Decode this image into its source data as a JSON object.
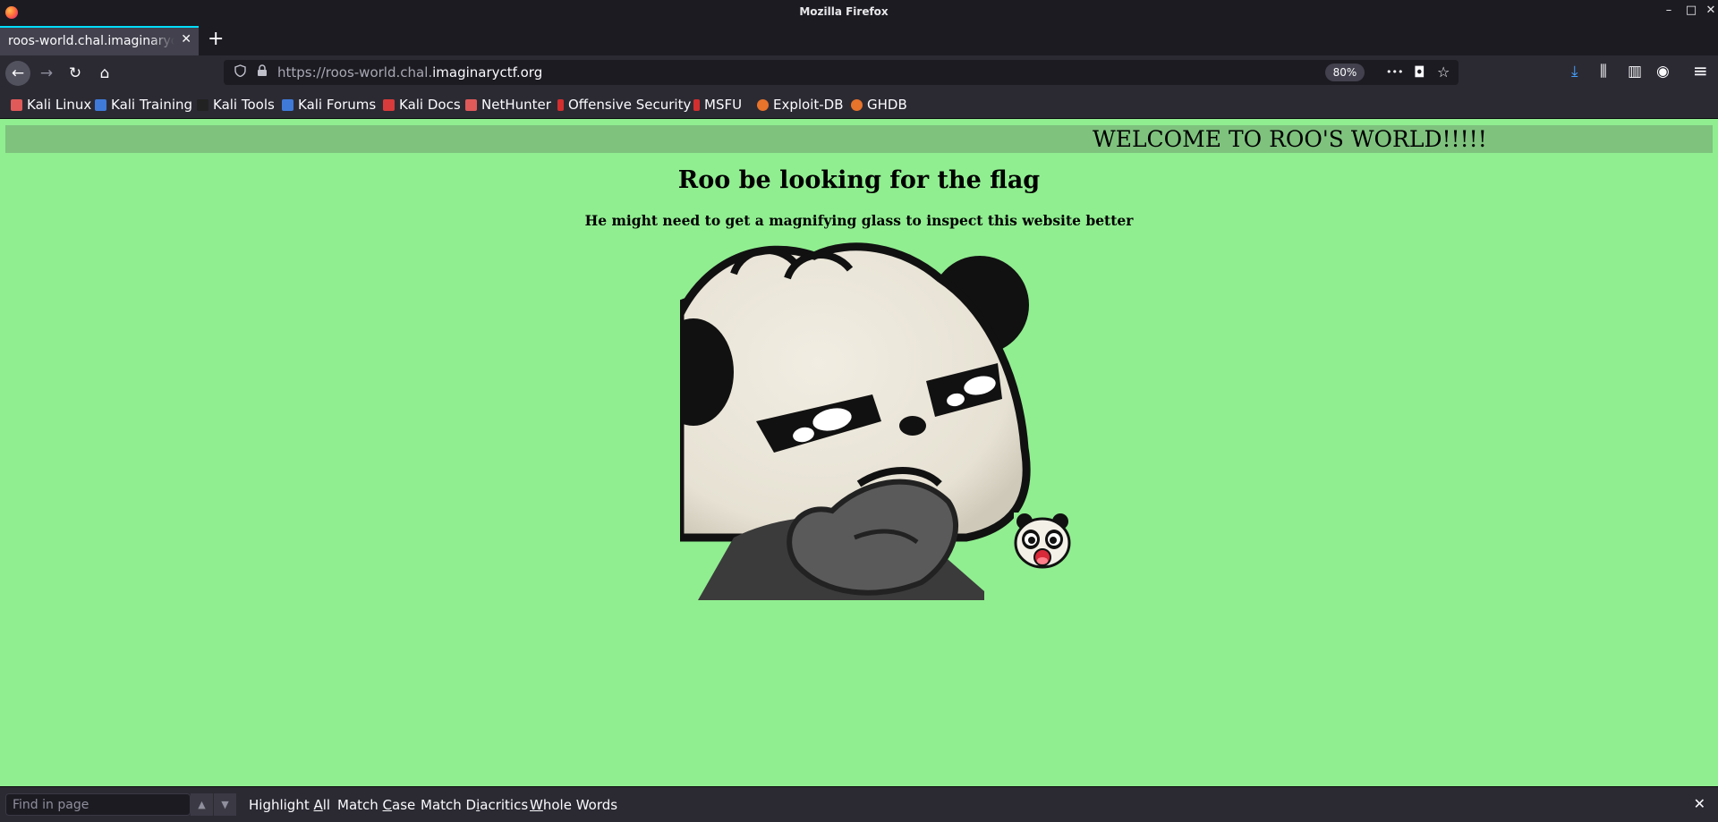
{
  "window": {
    "title": "Mozilla Firefox",
    "minimize_glyph": "–",
    "maximize_glyph": "□",
    "close_glyph": "✕"
  },
  "tabs": [
    {
      "label": "roos-world.chal.imaginaryctf.org",
      "close_glyph": "✕",
      "active": true
    }
  ],
  "new_tab_glyph": "+",
  "navbar": {
    "back_glyph": "←",
    "forward_glyph": "→",
    "reload_glyph": "↻",
    "home_glyph": "⌂",
    "url_prefix": "https://roos-world.chal.",
    "url_host": "imaginaryctf.org",
    "zoom": "80%",
    "page_actions_glyph": "•••",
    "pocket_glyph": "◘",
    "bookmark_glyph": "☆",
    "download_glyph": "⤓",
    "library_glyph": "⫼",
    "sidebar_glyph": "▥",
    "account_glyph": "◉",
    "menu_glyph": "≡"
  },
  "bookmarks": [
    {
      "label": "Kali Linux",
      "icon": "kali-dragon-icon",
      "color": "#e05a5a"
    },
    {
      "label": "Kali Training",
      "icon": "kali-training-icon",
      "color": "#3f7ad8"
    },
    {
      "label": "Kali Tools",
      "icon": "kali-tools-icon",
      "color": "#222222"
    },
    {
      "label": "Kali Forums",
      "icon": "kali-forums-icon",
      "color": "#3f7ad8"
    },
    {
      "label": "Kali Docs",
      "icon": "kali-docs-icon",
      "color": "#d83b3b"
    },
    {
      "label": "NetHunter",
      "icon": "nethunter-icon",
      "color": "#e05a5a"
    },
    {
      "label": "Offensive Security",
      "icon": "offsec-icon",
      "color": "#d32f2f"
    },
    {
      "label": "MSFU",
      "icon": "msfu-icon",
      "color": "#d32f2f"
    },
    {
      "label": "Exploit-DB",
      "icon": "exploit-db-icon",
      "color": "#e8732a"
    },
    {
      "label": "GHDB",
      "icon": "ghdb-icon",
      "color": "#e8732a"
    }
  ],
  "page": {
    "marquee": "WELCOME TO ROO'S WORLD!!!!!",
    "heading": "Roo be looking for the flag",
    "subheading": "He might need to get a magnifying glass to inspect this website better",
    "background_color": "#90ee90",
    "marquee_color": "#7ec27e"
  },
  "findbar": {
    "placeholder": "Find in page",
    "up_glyph": "▲",
    "down_glyph": "▼",
    "highlight_all": {
      "pre": "Highlight ",
      "ul": "A",
      "post": "ll"
    },
    "match_case": {
      "pre": "Match ",
      "ul": "C",
      "post": "ase"
    },
    "match_diacritics": {
      "pre": "Match D",
      "ul": "i",
      "post": "acritics"
    },
    "whole_words": {
      "pre": "",
      "ul": "W",
      "post": "hole Words"
    },
    "close_glyph": "✕"
  }
}
